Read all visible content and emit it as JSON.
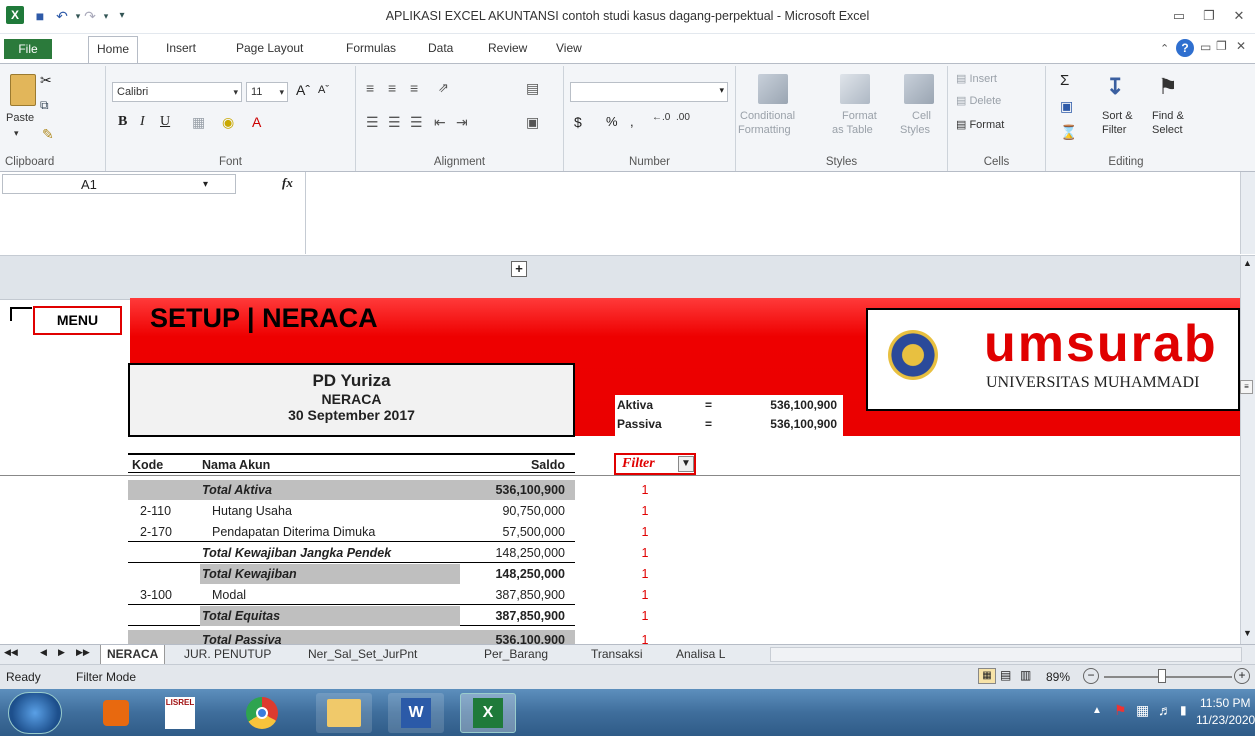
{
  "window": {
    "title": "APLIKASI EXCEL AKUNTANSI contoh studi kasus dagang-perpektual  -  Microsoft Excel"
  },
  "ribbon_tabs": [
    "File",
    "Home",
    "Insert",
    "Page Layout",
    "Formulas",
    "Data",
    "Review",
    "View"
  ],
  "clipboard": {
    "paste": "Paste",
    "label": "Clipboard"
  },
  "font": {
    "name": "Calibri",
    "size": "11",
    "label": "Font"
  },
  "alignment": {
    "label": "Alignment"
  },
  "number": {
    "label": "Number",
    "currency": "$",
    "percent": "%",
    "comma": ","
  },
  "styles": {
    "conditional": "Conditional",
    "formatting": "Formatting",
    "format": "Format",
    "as_table": "as Table",
    "cell": "Cell",
    "styles_btn": "Styles",
    "label": "Styles"
  },
  "cells": {
    "insert": "Insert",
    "delete": "Delete",
    "format": "Format",
    "label": "Cells"
  },
  "editing": {
    "sort": "Sort &",
    "filter": "Filter",
    "find": "Find &",
    "select": "Select",
    "label": "Editing"
  },
  "formula_bar": {
    "name_box": "A1",
    "fx": "fx",
    "value": ""
  },
  "sheet": {
    "menu_label": "MENU",
    "heading": "SETUP | NERACA",
    "company": "PD Yuriza",
    "report": "NERACA",
    "date": "30 September 2017",
    "logo_text": "umsurab",
    "logo_sub": "UNIVERSITAS MUHAMMADI",
    "aktiva_label": "Aktiva",
    "passiva_label": "Passiva",
    "eq": "=",
    "aktiva_value": "536,100,900",
    "passiva_value": "536,100,900",
    "col_kode": "Kode",
    "col_nama": "Nama Akun",
    "col_saldo": "Saldo",
    "filter_label": "Filter",
    "rows": [
      {
        "kode": "",
        "nama": "Total Aktiva",
        "saldo": "536,100,900",
        "flag": "1"
      },
      {
        "kode": "2-110",
        "nama": "Hutang Usaha",
        "saldo": "90,750,000",
        "flag": "1"
      },
      {
        "kode": "2-170",
        "nama": "Pendapatan Diterima Dimuka",
        "saldo": "57,500,000",
        "flag": "1"
      },
      {
        "kode": "",
        "nama": "Total Kewajiban Jangka Pendek",
        "saldo": "148,250,000",
        "flag": "1"
      },
      {
        "kode": "",
        "nama": "Total Kewajiban",
        "saldo": "148,250,000",
        "flag": "1"
      },
      {
        "kode": "3-100",
        "nama": "Modal",
        "saldo": "387,850,900",
        "flag": "1"
      },
      {
        "kode": "",
        "nama": "Total Equitas",
        "saldo": "387,850,900",
        "flag": "1"
      },
      {
        "kode": "",
        "nama": "Total Passiva",
        "saldo": "536,100,900",
        "flag": "1"
      }
    ]
  },
  "sheet_tabs": [
    "NERACA",
    "JUR. PENUTUP",
    "Ner_Sal_Set_JurPnt",
    "Per_Barang",
    "Transaksi",
    "Analisa L"
  ],
  "status": {
    "ready": "Ready",
    "filter_mode": "Filter Mode",
    "zoom": "89%"
  },
  "taskbar": {
    "time": "11:50 PM",
    "date": "11/23/2020",
    "lisrel": "LISREL"
  }
}
